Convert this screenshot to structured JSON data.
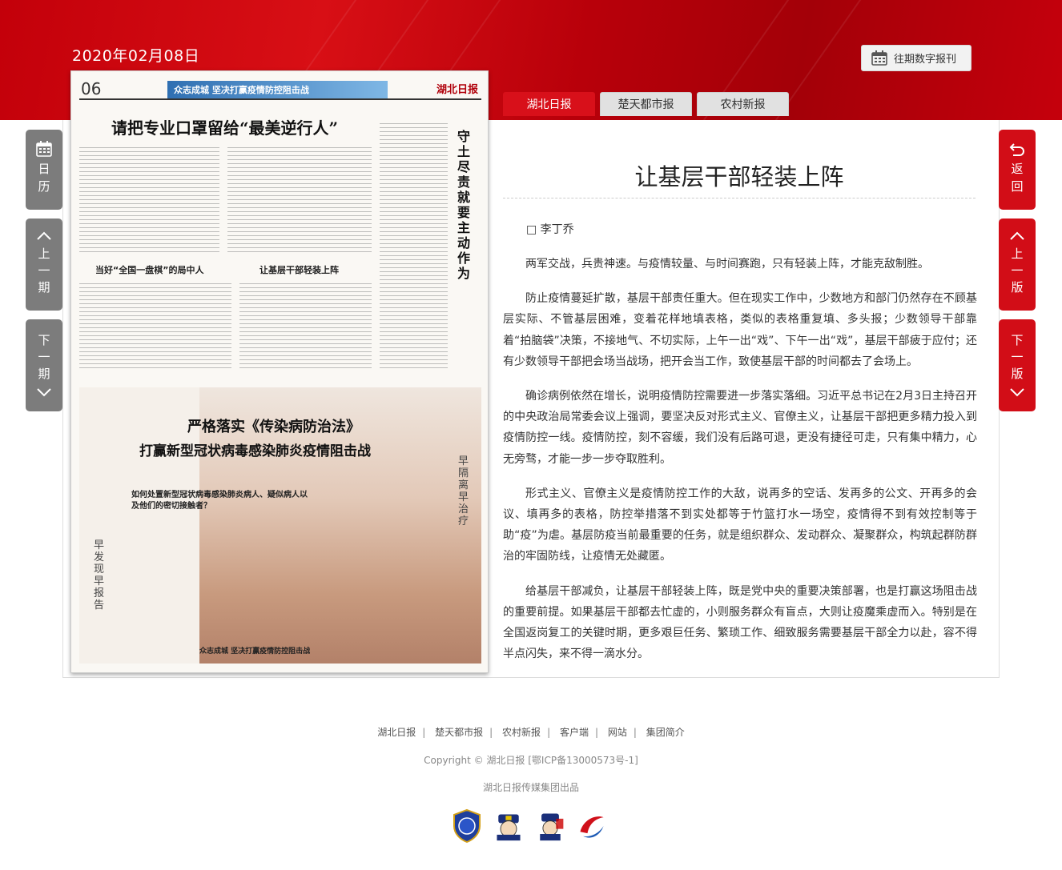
{
  "header": {
    "date": "2020年02月08日",
    "archive_button": "往期数字报刊"
  },
  "tabs": [
    {
      "label": "湖北日报",
      "active": true
    },
    {
      "label": "楚天都市报",
      "active": false
    },
    {
      "label": "农村新报",
      "active": false
    }
  ],
  "left_nav": {
    "calendar": "日历",
    "prev_issue": "上一期",
    "next_issue": "下一期"
  },
  "right_nav": {
    "back": "返回",
    "prev_page": "上一版",
    "next_page": "下一版"
  },
  "newspaper": {
    "page_number": "06",
    "banner_text": "众志成城 坚决打赢疫情防控阻击战",
    "masthead": "湖北日报",
    "headline_main": "请把专业口罩留给“最美逆行人”",
    "headline_side": "守土尽责就要主动作为",
    "sub_headline_1": "当好“全国一盘棋”的局中人",
    "sub_headline_2": "让基层干部轻装上阵",
    "poster_title_1": "严格落实《传染病防治法》",
    "poster_title_2": "打赢新型冠状病毒感染肺炎疫情阻击战",
    "poster_question": "如何处置新型冠状病毒感染肺炎病人、疑似病人以及他们的密切接触者？",
    "poster_vertical_left": "早发现早报告",
    "poster_vertical_right": "早隔离早治疗",
    "poster_footer": "众志成城 坚决打赢疫情防控阻击战"
  },
  "article": {
    "title": "让基层干部轻装上阵",
    "author": "□ 李丁乔",
    "paragraphs": [
      "两军交战，兵贵神速。与疫情较量、与时间赛跑，只有轻装上阵，才能克敌制胜。",
      "防止疫情蔓延扩散，基层干部责任重大。但在现实工作中，少数地方和部门仍然存在不顾基层实际、不管基层困难，变着花样地填表格，类似的表格重复填、多头报；少数领导干部靠着“拍脑袋”决策，不接地气、不切实际，上午一出“戏”、下午一出“戏”，基层干部疲于应付；还有少数领导干部把会场当战场，把开会当工作，致使基层干部的时间都去了会场上。",
      "确诊病例依然在增长，说明疫情防控需要进一步落实落细。习近平总书记在2月3日主持召开的中央政治局常委会议上强调，要坚决反对形式主义、官僚主义，让基层干部把更多精力投入到疫情防控一线。疫情防控，刻不容缓，我们没有后路可退，更没有捷径可走，只有集中精力，心无旁骛，才能一步一步夺取胜利。",
      "形式主义、官僚主义是疫情防控工作的大敌，说再多的空话、发再多的公文、开再多的会议、填再多的表格，防控举措落不到实处都等于竹篮打水一场空，疫情得不到有效控制等于助“疫”为虐。基层防疫当前最重要的任务，就是组织群众、发动群众、凝聚群众，构筑起群防群治的牢固防线，让疫情无处藏匿。",
      "给基层干部减负，让基层干部轻装上阵，既是党中央的重要决策部署，也是打赢这场阻击战的重要前提。如果基层干部都去忙虚的，小则服务群众有盲点，大则让疫魔乘虚而入。特别是在全国返岗复工的关键时期，更多艰巨任务、繁琐工作、细致服务需要基层干部全力以赴，容不得半点闪失，来不得一滴水分。"
    ]
  },
  "footer": {
    "links": [
      "湖北日报",
      "楚天都市报",
      "农村新报",
      "客户端",
      "网站",
      "集团简介"
    ],
    "copyright": "Copyright © 湖北日报 [鄂ICP备13000573号-1]",
    "publisher": "湖北日报传媒集团出品"
  },
  "colors": {
    "brand_red": "#d20d17",
    "nav_gray": "#7c7c7c"
  }
}
